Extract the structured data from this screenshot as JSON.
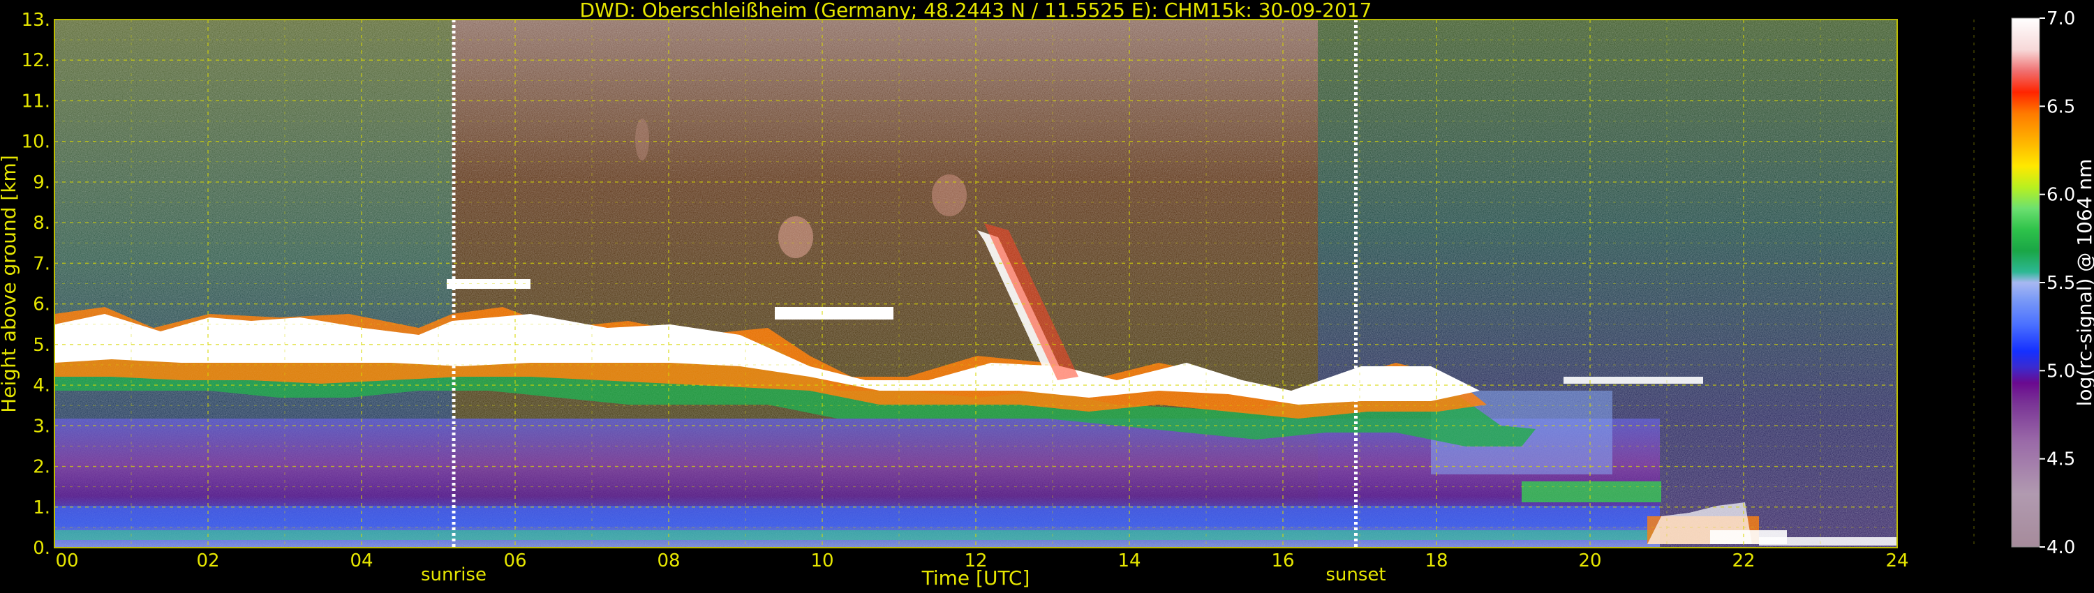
{
  "chart_data": {
    "type": "heatmap",
    "title": "DWD: Oberschleißheim (Germany; 48.2443 N / 11.5525 E):    CHM15k: 30-09-2017",
    "xlabel": "Time [UTC]",
    "ylabel": "Height above ground [km]",
    "xlim": [
      0,
      24
    ],
    "ylim": [
      0,
      13
    ],
    "x_ticks": [
      "00",
      "02",
      "04",
      "06",
      "08",
      "10",
      "12",
      "14",
      "16",
      "18",
      "20",
      "22",
      "24"
    ],
    "y_ticks": [
      "0.",
      "1.",
      "2.",
      "3.",
      "4.",
      "5.",
      "6.",
      "7.",
      "8.",
      "9.",
      "10.",
      "11.",
      "12.",
      "13."
    ],
    "grid": true,
    "grid_color": "#d8d800",
    "colorbar": {
      "label": "log(rc-signal) @ 1064 nm",
      "range": [
        4.0,
        7.0
      ],
      "ticks": [
        "4.0",
        "4.5",
        "5.0",
        "5.5",
        "6.0",
        "6.5",
        "7.0"
      ],
      "colors": [
        "#a68b9b",
        "#b19ab0",
        "#9a6aa8",
        "#7a3596",
        "#6a0a8f",
        "#3a2bd0",
        "#1530ff",
        "#4a70ff",
        "#7d9cf6",
        "#a8b8f2",
        "#b8c0ee",
        "#2db894",
        "#1aa646",
        "#2ec24a",
        "#6ce070",
        "#b8f020",
        "#ffe800",
        "#ffb000",
        "#ff7a00",
        "#ff2400",
        "#ff2a2a",
        "#f7d8d8",
        "#ffffff"
      ]
    },
    "events": [
      {
        "label": "sunrise",
        "time": 5.2
      },
      {
        "label": "sunset",
        "time": 16.95
      }
    ],
    "cloud_base_km": [
      {
        "t": 0.0,
        "h": 4.2
      },
      {
        "t": 2.0,
        "h": 3.9
      },
      {
        "t": 4.0,
        "h": 4.0
      },
      {
        "t": 6.0,
        "h": 4.2
      },
      {
        "t": 8.0,
        "h": 4.3
      },
      {
        "t": 10.0,
        "h": 3.8
      },
      {
        "t": 12.0,
        "h": 4.0
      },
      {
        "t": 14.0,
        "h": 3.9
      },
      {
        "t": 16.0,
        "h": 3.8
      },
      {
        "t": 18.0,
        "h": 3.2
      },
      {
        "t": 20.0,
        "h": 3.9
      },
      {
        "t": 21.0,
        "h": 1.0
      },
      {
        "t": 22.0,
        "h": 0.5
      }
    ]
  }
}
